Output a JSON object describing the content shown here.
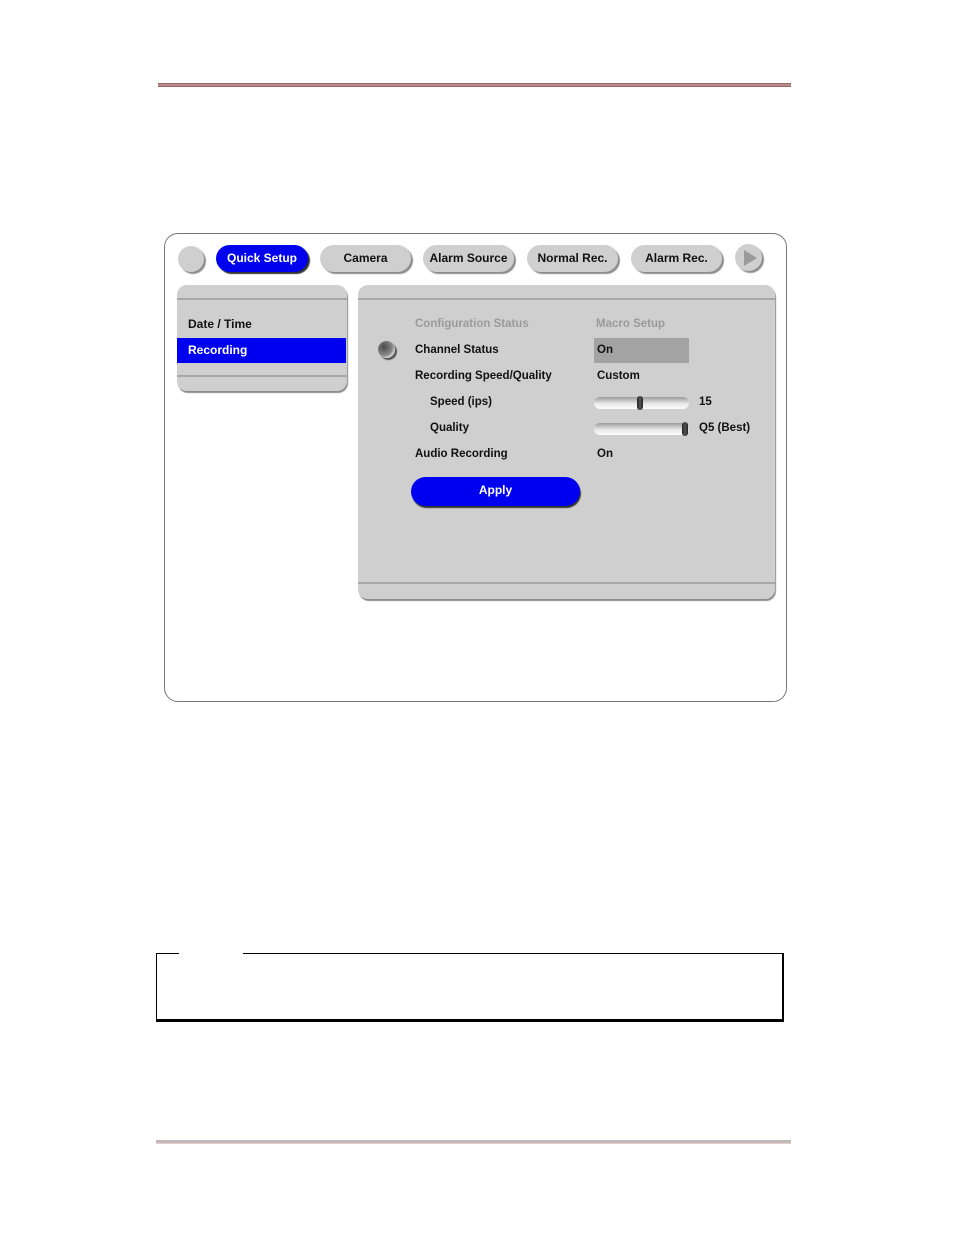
{
  "tabs": [
    {
      "label": "Quick Setup",
      "active": true
    },
    {
      "label": "Camera",
      "active": false
    },
    {
      "label": "Alarm Source",
      "active": false
    },
    {
      "label": "Normal Rec.",
      "active": false
    },
    {
      "label": "Alarm Rec.",
      "active": false
    }
  ],
  "nav": {
    "prev_icon": "blank-circle-icon",
    "next_icon": "play-arrow-icon"
  },
  "sidebar": {
    "items": [
      {
        "label": "Date / Time",
        "selected": false
      },
      {
        "label": "Recording",
        "selected": true
      }
    ]
  },
  "settings": {
    "header_left": "Configuration Status",
    "header_right": "Macro Setup",
    "rows": [
      {
        "label": "Channel Status",
        "value": "On"
      },
      {
        "label": "Recording Speed/Quality",
        "value": "Custom"
      },
      {
        "label": "Speed (ips)",
        "value": "15",
        "slider_fraction": 0.48
      },
      {
        "label": "Quality",
        "value": "Q5 (Best)",
        "slider_fraction": 1.0
      },
      {
        "label": "Audio Recording",
        "value": "On"
      }
    ],
    "apply_label": "Apply"
  },
  "colors": {
    "accent": "#0000f0",
    "panel": "#cfcfcf",
    "header_rule": "#a87575"
  }
}
